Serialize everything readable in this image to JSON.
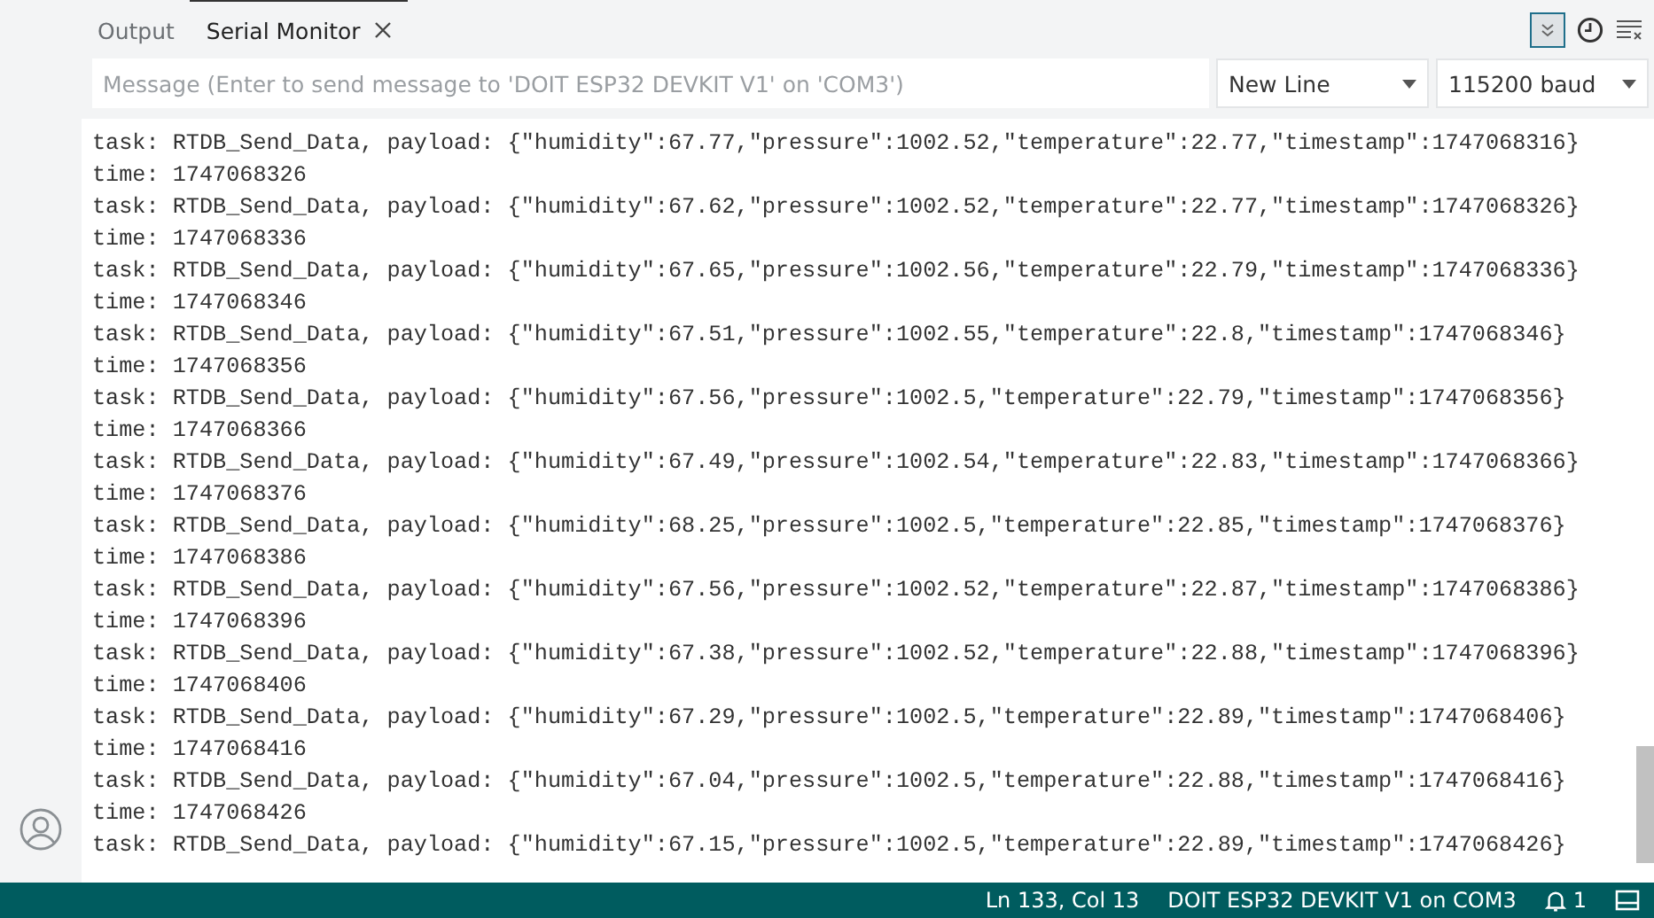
{
  "tabs": [
    {
      "label": "Output",
      "selected": false,
      "closable": false
    },
    {
      "label": "Serial Monitor",
      "selected": true,
      "closable": true
    }
  ],
  "toolbar": {
    "autoscroll_on": true
  },
  "message": {
    "placeholder": "Message (Enter to send message to 'DOIT ESP32 DEVKIT V1' on 'COM3')"
  },
  "line_ending": {
    "value": "New Line"
  },
  "baud_rate": {
    "value": "115200 baud"
  },
  "log": [
    "task: RTDB_Send_Data, payload: {\"humidity\":67.77,\"pressure\":1002.52,\"temperature\":22.77,\"timestamp\":1747068316}",
    "time: 1747068326",
    "task: RTDB_Send_Data, payload: {\"humidity\":67.62,\"pressure\":1002.52,\"temperature\":22.77,\"timestamp\":1747068326}",
    "time: 1747068336",
    "task: RTDB_Send_Data, payload: {\"humidity\":67.65,\"pressure\":1002.56,\"temperature\":22.79,\"timestamp\":1747068336}",
    "time: 1747068346",
    "task: RTDB_Send_Data, payload: {\"humidity\":67.51,\"pressure\":1002.55,\"temperature\":22.8,\"timestamp\":1747068346}",
    "time: 1747068356",
    "task: RTDB_Send_Data, payload: {\"humidity\":67.56,\"pressure\":1002.5,\"temperature\":22.79,\"timestamp\":1747068356}",
    "time: 1747068366",
    "task: RTDB_Send_Data, payload: {\"humidity\":67.49,\"pressure\":1002.54,\"temperature\":22.83,\"timestamp\":1747068366}",
    "time: 1747068376",
    "task: RTDB_Send_Data, payload: {\"humidity\":68.25,\"pressure\":1002.5,\"temperature\":22.85,\"timestamp\":1747068376}",
    "time: 1747068386",
    "task: RTDB_Send_Data, payload: {\"humidity\":67.56,\"pressure\":1002.52,\"temperature\":22.87,\"timestamp\":1747068386}",
    "time: 1747068396",
    "task: RTDB_Send_Data, payload: {\"humidity\":67.38,\"pressure\":1002.52,\"temperature\":22.88,\"timestamp\":1747068396}",
    "time: 1747068406",
    "task: RTDB_Send_Data, payload: {\"humidity\":67.29,\"pressure\":1002.5,\"temperature\":22.89,\"timestamp\":1747068406}",
    "time: 1747068416",
    "task: RTDB_Send_Data, payload: {\"humidity\":67.04,\"pressure\":1002.5,\"temperature\":22.88,\"timestamp\":1747068416}",
    "time: 1747068426",
    "task: RTDB_Send_Data, payload: {\"humidity\":67.15,\"pressure\":1002.5,\"temperature\":22.89,\"timestamp\":1747068426}"
  ],
  "status_bar": {
    "position": "Ln 133, Col 13",
    "board": "DOIT ESP32 DEVKIT V1 on COM3",
    "notifications": "1"
  }
}
